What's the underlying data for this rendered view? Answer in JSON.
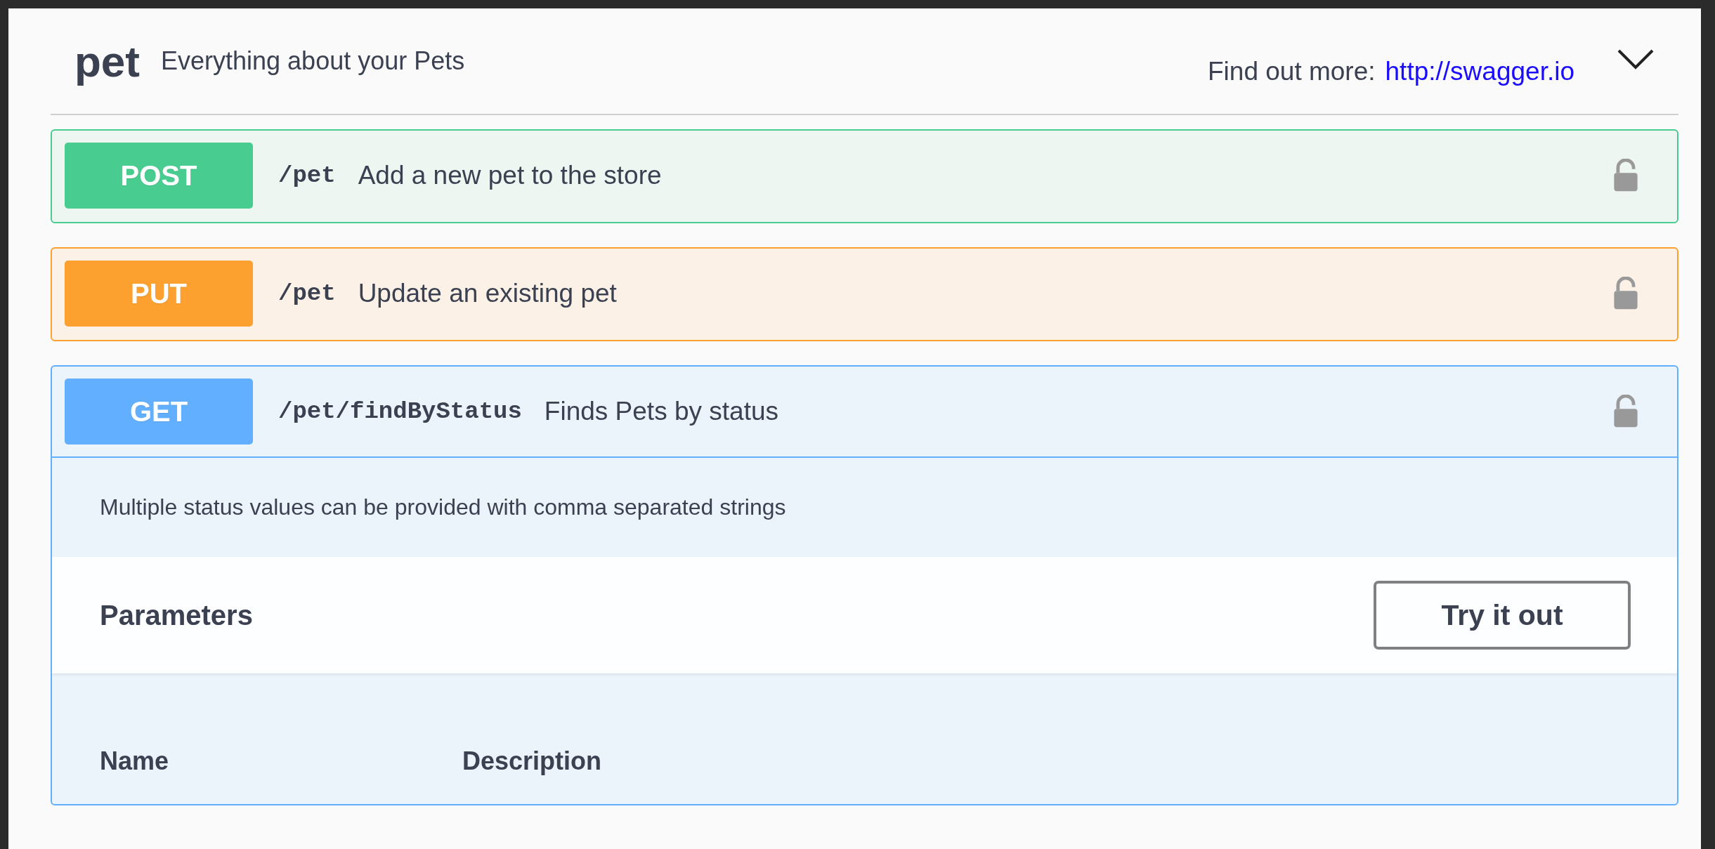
{
  "tag": {
    "name": "pet",
    "description": "Everything about your Pets",
    "more_label": "Find out more:",
    "more_link": "http://swagger.io",
    "expanded": true
  },
  "operations": [
    {
      "kind": "post",
      "method": "POST",
      "path": "/pet",
      "summary": "Add a new pet to the store",
      "expanded": false
    },
    {
      "kind": "put",
      "method": "PUT",
      "path": "/pet",
      "summary": "Update an existing pet",
      "expanded": false
    },
    {
      "kind": "get",
      "method": "GET",
      "path": "/pet/findByStatus",
      "summary": "Finds Pets by status",
      "expanded": true,
      "description": "Multiple status values can be provided with comma separated strings",
      "parameters_title": "Parameters",
      "try_button": "Try it out",
      "columns": [
        "Name",
        "Description"
      ]
    }
  ]
}
